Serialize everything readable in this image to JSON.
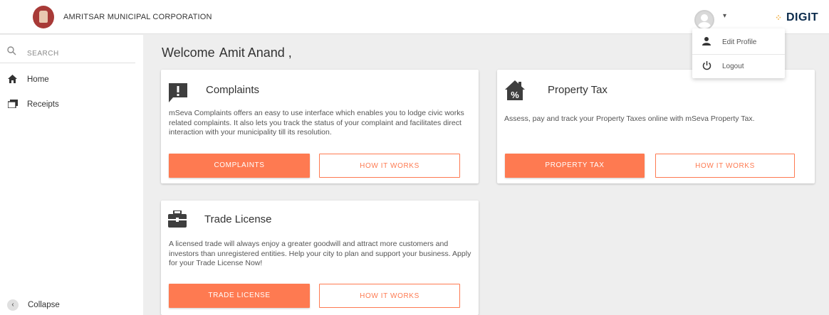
{
  "header": {
    "corp_name": "AMRITSAR MUNICIPAL CORPORATION",
    "brand": "DIGIT",
    "avatar_icon": "user-avatar-icon",
    "caret_icon": "caret-down-icon"
  },
  "user_menu": {
    "items": [
      {
        "label": "Edit Profile",
        "icon": "person-icon"
      },
      {
        "label": "Logout",
        "icon": "power-icon"
      }
    ]
  },
  "sidebar": {
    "search_label": "SEARCH",
    "items": [
      {
        "label": "Home",
        "icon": "home-icon"
      },
      {
        "label": "Receipts",
        "icon": "receipts-icon"
      }
    ],
    "collapse_label": "Collapse"
  },
  "main": {
    "welcome_prefix": "Welcome",
    "user_name": "Amit Anand",
    "welcome_suffix": ",",
    "cards": [
      {
        "title": "Complaints",
        "icon": "complaint-icon",
        "description": "mSeva Complaints offers an easy to use interface which enables you to lodge civic works related complaints. It also lets you track the status of your complaint and facilitates direct interaction with your municipality till its resolution.",
        "primary_button": "COMPLAINTS",
        "secondary_button": "HOW IT WORKS"
      },
      {
        "title": "Property Tax",
        "icon": "property-tax-icon",
        "description": "Assess, pay and track your Property Taxes online with mSeva Property Tax.",
        "primary_button": "PROPERTY TAX",
        "secondary_button": "HOW IT WORKS"
      },
      {
        "title": "Trade License",
        "icon": "briefcase-icon",
        "description": "A licensed trade will always enjoy a greater goodwill and attract more customers and investors than unregistered entities. Help your city to plan and support your business. Apply for your Trade License Now!",
        "primary_button": "TRADE LICENSE",
        "secondary_button": "HOW IT WORKS"
      }
    ]
  },
  "colors": {
    "accent": "#fe7a51",
    "emblem": "#a83a37",
    "brand_text": "#0b2b4c"
  }
}
